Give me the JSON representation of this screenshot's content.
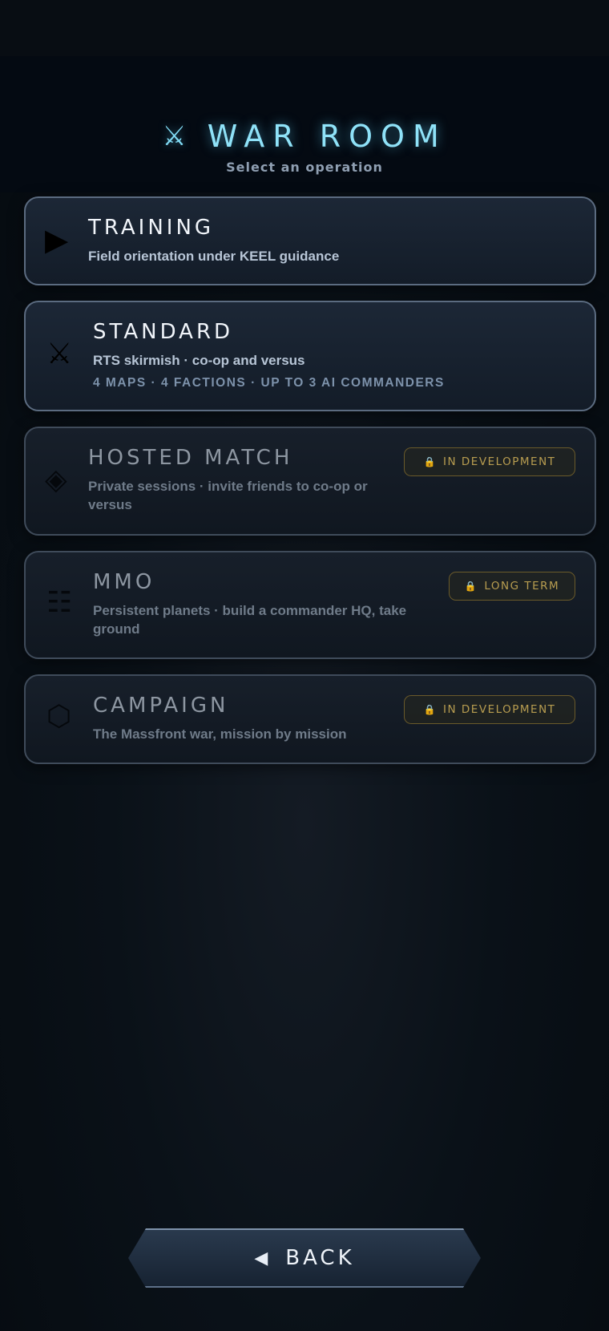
{
  "header": {
    "icon": "crossed-swords-icon",
    "icon_glyph": "⚔",
    "title": "WAR ROOM",
    "subtitle": "Select an operation",
    "accent_color": "#8fe2f8"
  },
  "cards": [
    {
      "icon": "play-icon",
      "icon_glyph": "▶",
      "title": "TRAINING",
      "description": "Field orientation under KEEL guidance"
    },
    {
      "icon": "crossed-swords-icon",
      "icon_glyph": "⚔",
      "title": "STANDARD",
      "description": "RTS skirmish · co-op and versus",
      "meta": "4 MAPS · 4 FACTIONS · UP TO 3 AI COMMANDERS"
    },
    {
      "icon": "diamond-icon",
      "icon_glyph": "◈",
      "title": "HOSTED MATCH",
      "description": "Private sessions · invite friends to co-op or versus",
      "badge": "IN DEVELOPMENT",
      "locked": true
    },
    {
      "icon": "grid-icon",
      "icon_glyph": "☷",
      "title": "MMO",
      "description": "Persistent planets · build a commander HQ, take ground",
      "badge": "LONG TERM",
      "locked": true
    },
    {
      "icon": "hexagon-icon",
      "icon_glyph": "⬡",
      "title": "CAMPAIGN",
      "description": "The Massfront war, mission by mission",
      "badge": "IN DEVELOPMENT",
      "locked": true
    }
  ],
  "lock_glyph": "🔒",
  "badge_color": "#b89d50",
  "back": {
    "icon": "back-arrow-icon",
    "icon_glyph": "◀",
    "label": "BACK"
  }
}
